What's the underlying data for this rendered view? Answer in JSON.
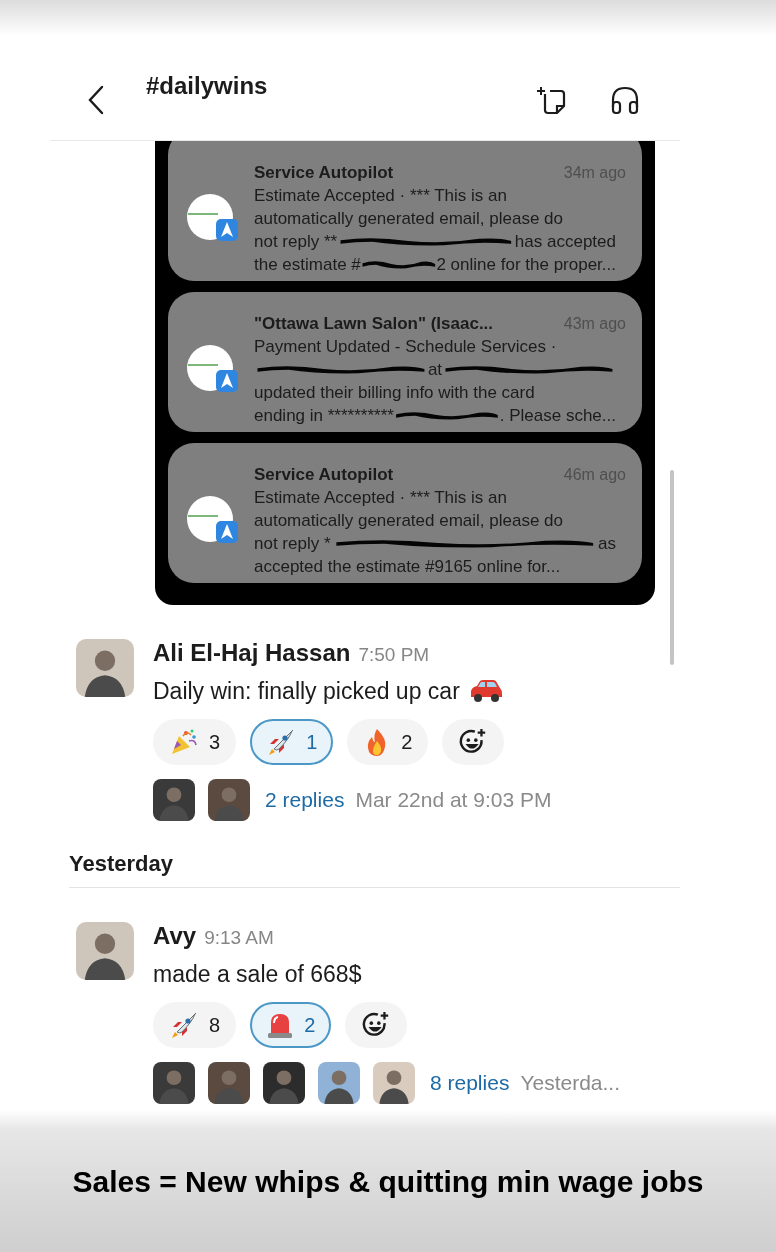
{
  "header": {
    "channel": "#dailywins"
  },
  "attachment": {
    "notifications": [
      {
        "title": "Service Autopilot",
        "time": "34m ago",
        "lines": [
          [
            {
              "kind": "text",
              "text": "Estimate Accepted · *** This is an"
            }
          ],
          [
            {
              "kind": "text",
              "text": "automatically generated email, please do"
            }
          ],
          [
            {
              "kind": "text",
              "text": "not reply **"
            },
            {
              "kind": "redaction"
            },
            {
              "kind": "text",
              "text": "has accepted"
            }
          ],
          [
            {
              "kind": "text",
              "text": "the estimate #"
            },
            {
              "kind": "redaction"
            },
            {
              "kind": "text",
              "text": "2 online for the proper..."
            }
          ]
        ]
      },
      {
        "title": "\"Ottawa Lawn Salon\" (Isaac...",
        "time": "43m ago",
        "lines": [
          [
            {
              "kind": "text",
              "text": "Payment Updated - Schedule Services ·"
            }
          ],
          [
            {
              "kind": "redaction"
            },
            {
              "kind": "text",
              "text": "at"
            },
            {
              "kind": "redaction"
            }
          ],
          [
            {
              "kind": "text",
              "text": "updated their billing info with the card"
            }
          ],
          [
            {
              "kind": "text",
              "text": "ending in **********"
            },
            {
              "kind": "redaction"
            },
            {
              "kind": "text",
              "text": ". Please sche..."
            }
          ]
        ]
      },
      {
        "title": "Service Autopilot",
        "time": "46m ago",
        "lines": [
          [
            {
              "kind": "text",
              "text": "Estimate Accepted · *** This is an"
            }
          ],
          [
            {
              "kind": "text",
              "text": "automatically generated email, please do"
            }
          ],
          [
            {
              "kind": "text",
              "text": "not reply *"
            },
            {
              "kind": "redaction"
            },
            {
              "kind": "text",
              "text": "as"
            }
          ],
          [
            {
              "kind": "text",
              "text": "accepted the estimate #9165 online for..."
            }
          ]
        ]
      }
    ]
  },
  "items": [
    {
      "kind": "message",
      "author": "Ali El-Haj Hassan",
      "time": "7:50 PM",
      "text": "Daily win: finally picked up car",
      "trailing_emoji": {
        "kind": "car"
      },
      "reactions": [
        {
          "kind": "party",
          "count": "3",
          "selected": false
        },
        {
          "kind": "rocket",
          "count": "1",
          "selected": true
        },
        {
          "kind": "fire",
          "count": "2",
          "selected": false
        }
      ],
      "reply_avatars": [
        {
          "kind": "avatar"
        },
        {
          "kind": "avatar"
        }
      ],
      "replies": "2 replies",
      "last_reply": "Mar 22nd at 9:03 PM"
    },
    {
      "kind": "date_divider",
      "label": "Yesterday"
    },
    {
      "kind": "message",
      "author": "Avy",
      "time": "9:13 AM",
      "text": "made a sale of 668$",
      "reactions": [
        {
          "kind": "rocket",
          "count": "8",
          "selected": false
        },
        {
          "kind": "siren",
          "count": "2",
          "selected": true
        }
      ],
      "reply_avatars": [
        {
          "kind": "avatar"
        },
        {
          "kind": "avatar"
        },
        {
          "kind": "avatar"
        },
        {
          "kind": "avatar"
        },
        {
          "kind": "avatar"
        }
      ],
      "replies": "8 replies",
      "last_reply": "Yesterda..."
    }
  ],
  "caption": "Sales = New whips & quitting min wage jobs"
}
